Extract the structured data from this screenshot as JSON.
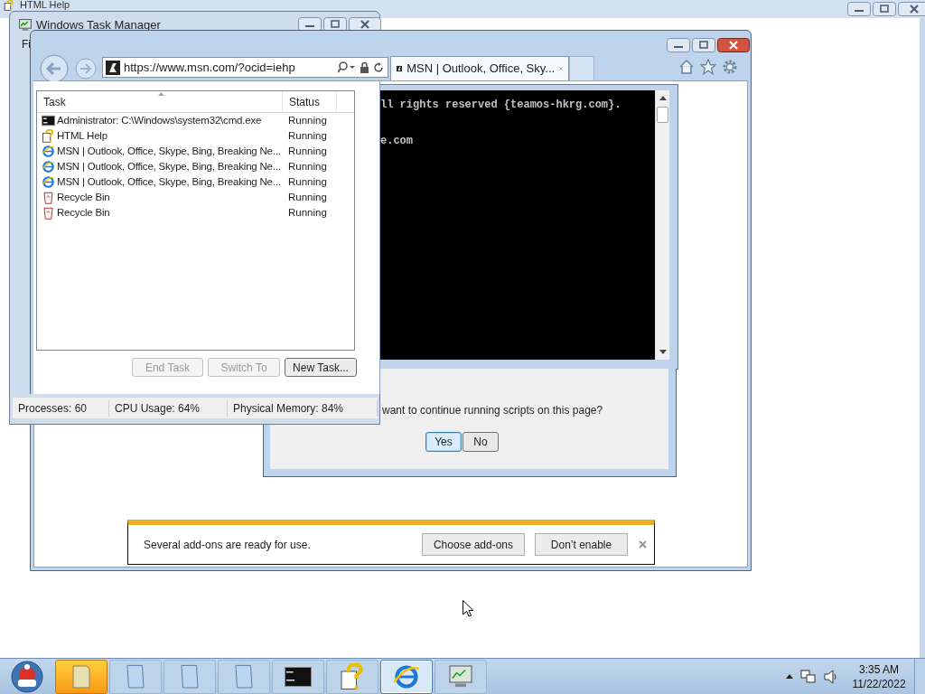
{
  "background_window": {
    "title": "HTML Help"
  },
  "task_manager": {
    "title": "Windows Task Manager",
    "menu": [
      "Fi"
    ],
    "columns": [
      "Task",
      "Status"
    ],
    "rows": [
      {
        "kind": "console",
        "task": "Administrator: C:\\Windows\\system32\\cmd.exe",
        "status": "Running"
      },
      {
        "kind": "help",
        "task": "HTML Help",
        "status": "Running"
      },
      {
        "kind": "browser",
        "task": "MSN | Outlook, Office, Skype, Bing, Breaking Ne...",
        "status": "Running"
      },
      {
        "kind": "browser",
        "task": "MSN | Outlook, Office, Skype, Bing, Breaking Ne...",
        "status": "Running"
      },
      {
        "kind": "browser",
        "task": "MSN | Outlook, Office, Skype, Bing, Breaking Ne...",
        "status": "Running"
      },
      {
        "kind": "recycle",
        "task": "Recycle Bin",
        "status": "Running"
      },
      {
        "kind": "recycle",
        "task": "Recycle Bin",
        "status": "Running"
      }
    ],
    "buttons": [
      {
        "label": "End Task",
        "disabled": true
      },
      {
        "label": "Switch To",
        "disabled": true
      },
      {
        "label": "New Task...",
        "disabled": false
      }
    ],
    "status_bar": [
      "Processes: 60",
      "CPU Usage: 64%",
      "Physical Memory: 84%"
    ]
  },
  "browser": {
    "address": "https://www.msn.com/?ocid=iehp",
    "tab": {
      "title": "MSN | Outlook, Office, Sky..."
    },
    "notification": {
      "message": "Several add-ons are ready for use.",
      "buttons": [
        "Choose add-ons",
        "Don’t enable"
      ]
    }
  },
  "console": {
    "lines": [
      "ll rights reserved {teamos-hkrg.com}.",
      "e.com"
    ]
  },
  "script_dialog": {
    "message": "want to continue running scripts on this page?",
    "buttons": [
      {
        "label": "Yes",
        "selected": true
      },
      {
        "label": "No",
        "selected": false
      }
    ]
  },
  "taskbar": {
    "items": [
      {
        "kind": "folder",
        "flashing": true,
        "selected": false
      },
      {
        "kind": "window",
        "flashing": false,
        "selected": false
      },
      {
        "kind": "window",
        "flashing": false,
        "selected": false
      },
      {
        "kind": "window",
        "flashing": false,
        "selected": false
      },
      {
        "kind": "console",
        "flashing": false,
        "selected": false
      },
      {
        "kind": "help",
        "flashing": false,
        "selected": false
      },
      {
        "kind": "browser",
        "flashing": false,
        "selected": true
      },
      {
        "kind": "monitor",
        "flashing": false,
        "selected": false
      }
    ],
    "clock": {
      "time": "3:35 AM",
      "date": "11/22/2022"
    }
  }
}
